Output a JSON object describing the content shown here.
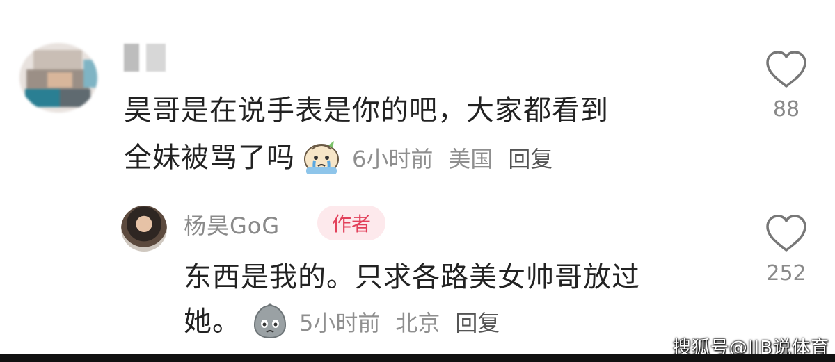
{
  "comment": {
    "text_line1": "昊哥是在说手表是你的吧，大家都看到",
    "text_line2": "全妹被骂了吗",
    "time": "6小时前",
    "location": "美国",
    "reply_label": "回复",
    "like_count": "88"
  },
  "reply": {
    "username": "杨昊GoG",
    "badge": "作者",
    "text_line1": "东西是我的。只求各路美女帅哥放过",
    "text_line2": "她。",
    "time": "5小时前",
    "location": "北京",
    "reply_label": "回复",
    "like_count": "252"
  },
  "watermark": "搜狐号@JJB说体育",
  "icons": {
    "like": "heart-outline-icon",
    "emoji_1": "crying-emoji-icon",
    "emoji_2": "sad-emoji-icon"
  },
  "colors": {
    "author_badge_bg": "#fde9ec",
    "author_badge_text": "#e2405a"
  }
}
